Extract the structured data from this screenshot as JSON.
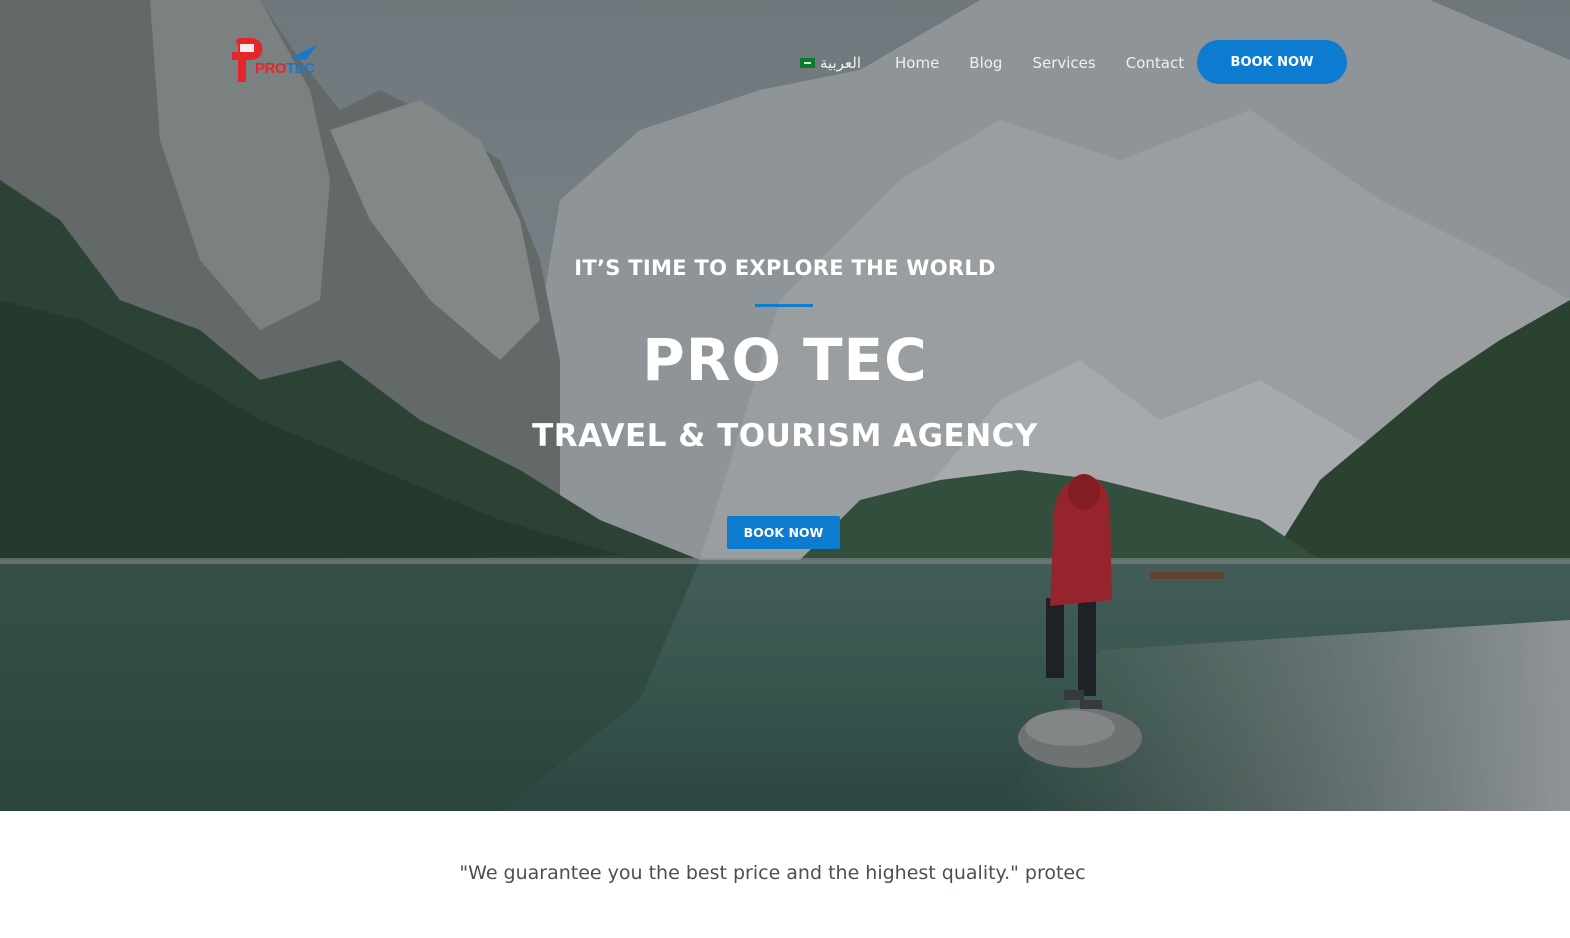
{
  "header": {
    "logo": {
      "pro": "PRO",
      "tec": "TEC",
      "brand_red": "#e3262c",
      "brand_blue": "#1a78c9"
    },
    "language_label": "العربية",
    "flag_icon": "saudi-flag-icon",
    "nav": [
      "Home",
      "Blog",
      "Services",
      "Contact"
    ],
    "cta_label": "BOOK NOW"
  },
  "hero": {
    "tagline": "IT’S TIME TO EXPLORE THE WORLD",
    "title": "PRO TEC",
    "subtitle": "TRAVEL & TOURISM AGENCY",
    "cta_label": "BOOK NOW",
    "accent_color": "#0c7bd0"
  },
  "quote": "\"We guarantee you the best price and the highest quality.\" protec"
}
